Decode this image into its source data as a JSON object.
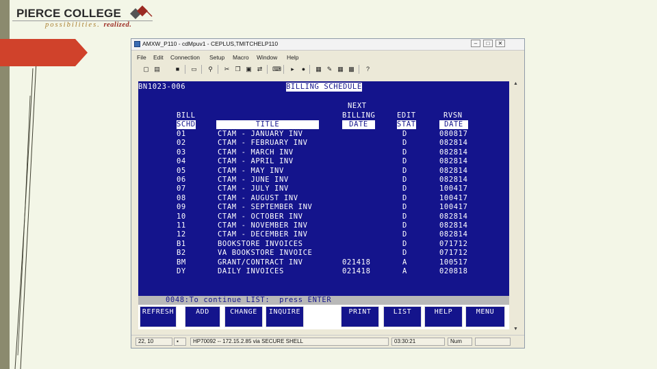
{
  "logo": {
    "name": "PIERCE COLLEGE",
    "tagline": "possibilities.",
    "tagline_bold": "realized."
  },
  "window": {
    "title": "AMXW_P110 - cdMpuv1 - CEPLUS,TMITCHELP110",
    "menu": [
      "File",
      "Edit",
      "Connection",
      "Setup",
      "Macro",
      "Window",
      "Help"
    ]
  },
  "screen": {
    "id": "BN1023-006",
    "title": "BILLING SCHEDULE",
    "headers": {
      "bill_top": "BILL",
      "bill": "SCHD",
      "title": "TITLE",
      "next_1": "NEXT",
      "next_2": "BILLING",
      "next_3": "DATE",
      "edit_top": "EDIT",
      "edit": "STAT",
      "rvsn_top": "RVSN",
      "rvsn": "DATE"
    },
    "rows": [
      {
        "schd": "01",
        "title": "CTAM - JANUARY INV",
        "next": "",
        "stat": "D",
        "rvsn": "080817"
      },
      {
        "schd": "02",
        "title": "CTAM - FEBRUARY INV",
        "next": "",
        "stat": "D",
        "rvsn": "082814"
      },
      {
        "schd": "03",
        "title": "CTAM - MARCH INV",
        "next": "",
        "stat": "D",
        "rvsn": "082814"
      },
      {
        "schd": "04",
        "title": "CTAM - APRIL INV",
        "next": "",
        "stat": "D",
        "rvsn": "082814"
      },
      {
        "schd": "05",
        "title": "CTAM - MAY INV",
        "next": "",
        "stat": "D",
        "rvsn": "082814"
      },
      {
        "schd": "06",
        "title": "CTAM - JUNE INV",
        "next": "",
        "stat": "D",
        "rvsn": "082814"
      },
      {
        "schd": "07",
        "title": "CTAM - JULY INV",
        "next": "",
        "stat": "D",
        "rvsn": "100417"
      },
      {
        "schd": "08",
        "title": "CTAM - AUGUST INV",
        "next": "",
        "stat": "D",
        "rvsn": "100417"
      },
      {
        "schd": "09",
        "title": "CTAM - SEPTEMBER INV",
        "next": "",
        "stat": "D",
        "rvsn": "100417"
      },
      {
        "schd": "10",
        "title": "CTAM - OCTOBER INV",
        "next": "",
        "stat": "D",
        "rvsn": "082814"
      },
      {
        "schd": "11",
        "title": "CTAM - NOVEMBER INV",
        "next": "",
        "stat": "D",
        "rvsn": "082814"
      },
      {
        "schd": "12",
        "title": "CTAM - DECEMBER INV",
        "next": "",
        "stat": "D",
        "rvsn": "082814"
      },
      {
        "schd": "B1",
        "title": "BOOKSTORE INVOICES",
        "next": "",
        "stat": "D",
        "rvsn": "071712"
      },
      {
        "schd": "B2",
        "title": "VA BOOKSTORE INVOICE",
        "next": "",
        "stat": "D",
        "rvsn": "071712"
      },
      {
        "schd": "BM",
        "title": "GRANT/CONTRACT INV",
        "next": "021418",
        "stat": "A",
        "rvsn": "100517"
      },
      {
        "schd": "DY",
        "title": "DAILY INVOICES",
        "next": "021418",
        "stat": "A",
        "rvsn": "020818"
      }
    ],
    "message": "0048:To continue LIST:  press ENTER",
    "fkeys": [
      "REFRESH",
      "ADD",
      "CHANGE",
      "INQUIRE",
      "PRINT",
      "LIST",
      "HELP",
      "MENU"
    ]
  },
  "status": {
    "cursor": "22, 10",
    "session": "HP70092 -- 172.15.2.85 via SECURE SHELL",
    "time": "03:30:21",
    "num": "Num"
  }
}
